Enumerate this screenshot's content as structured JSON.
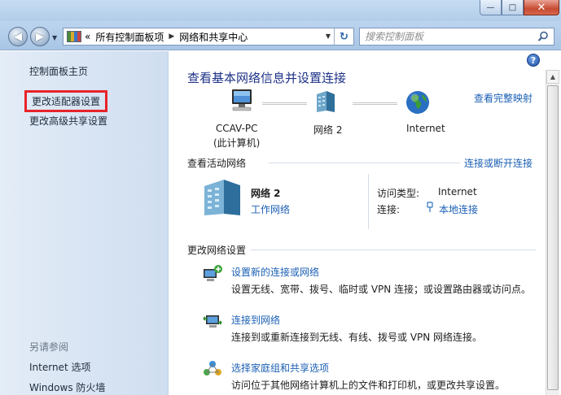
{
  "window": {
    "minimize": "—",
    "maximize": "□",
    "close": "✕"
  },
  "nav": {
    "back": "◀",
    "forward": "▶",
    "breadcrumbs": [
      "所有控制面板项",
      "网络和共享中心"
    ],
    "crumb_prefix": "«",
    "separator": "▶",
    "search_placeholder": "搜索控制面板"
  },
  "sidebar": {
    "items": [
      {
        "label": "控制面板主页"
      },
      {
        "label": "更改适配器设置"
      },
      {
        "label": "更改高级共享设置"
      }
    ],
    "see_also_title": "另请参阅",
    "see_also": [
      {
        "label": "Internet 选项"
      },
      {
        "label": "Windows 防火墙"
      }
    ]
  },
  "main": {
    "title": "查看基本网络信息并设置连接",
    "full_map_link": "查看完整映射",
    "map": {
      "computer_name": "CCAV-PC",
      "computer_sub": "(此计算机)",
      "network": "网络  2",
      "internet": "Internet"
    },
    "active": {
      "heading": "查看活动网络",
      "connect_link": "连接或断开连接",
      "network_name": "网络  2",
      "network_type": "工作网络",
      "access_label": "访问类型:",
      "access_value": "Internet",
      "conn_label": "连接:",
      "conn_value": "本地连接"
    },
    "change": {
      "heading": "更改网络设置",
      "tasks": [
        {
          "title": "设置新的连接或网络",
          "desc": "设置无线、宽带、拨号、临时或 VPN 连接；或设置路由器或访问点。"
        },
        {
          "title": "连接到网络",
          "desc": "连接到或重新连接到无线、有线、拨号或 VPN 网络连接。"
        },
        {
          "title": "选择家庭组和共享选项",
          "desc": "访问位于其他网络计算机上的文件和打印机，或更改共享设置。"
        }
      ]
    },
    "help": "?"
  },
  "colors": {
    "link": "#1a5fb4",
    "title": "#1e3287",
    "highlight_box": "#e8232a"
  }
}
